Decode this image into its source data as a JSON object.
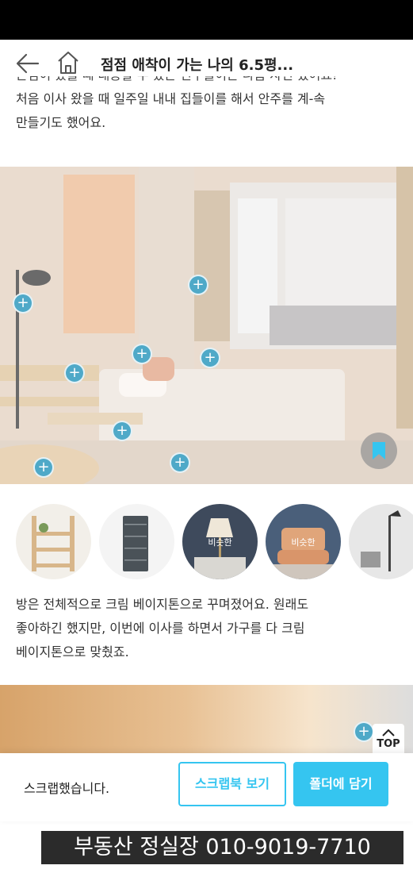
{
  "header": {
    "title": "점점 애착이 가는 나의 6.5평..."
  },
  "article": {
    "intro_lines": [
      "손님이 왔을 때 대응할 수 있는 친구들이는 나름 자신 있어요!",
      "처음 이사 왔을 때 일주일 내내 집들이를 해서 안주를 계-속",
      "만들기도 했어요."
    ],
    "body_lines": [
      "방은 전체적으로 크림 베이지톤으로 꾸며졌어요. 원래도",
      "좋아하긴 했지만, 이번에 이사를 하면서 가구를 다 크림",
      "베이지톤으로 맞췄죠."
    ]
  },
  "products": {
    "items": [
      {
        "name": "wooden-shelf",
        "tag": ""
      },
      {
        "name": "drawer-cabinet",
        "tag": ""
      },
      {
        "name": "table-lamp",
        "tag": "비슷한"
      },
      {
        "name": "floor-chair",
        "tag": "비슷한"
      },
      {
        "name": "floor-lamp",
        "tag": ""
      }
    ]
  },
  "toast": {
    "message": "스크랩했습니다.",
    "view_button": "스크랩북 보기",
    "folder_button": "폴더에 담기"
  },
  "top_button": {
    "label": "TOP"
  },
  "banner": {
    "text": "부동산 정실장 010-9019-7710"
  },
  "colors": {
    "accent": "#35c5f0",
    "hotspot": "#4fa9c8"
  }
}
